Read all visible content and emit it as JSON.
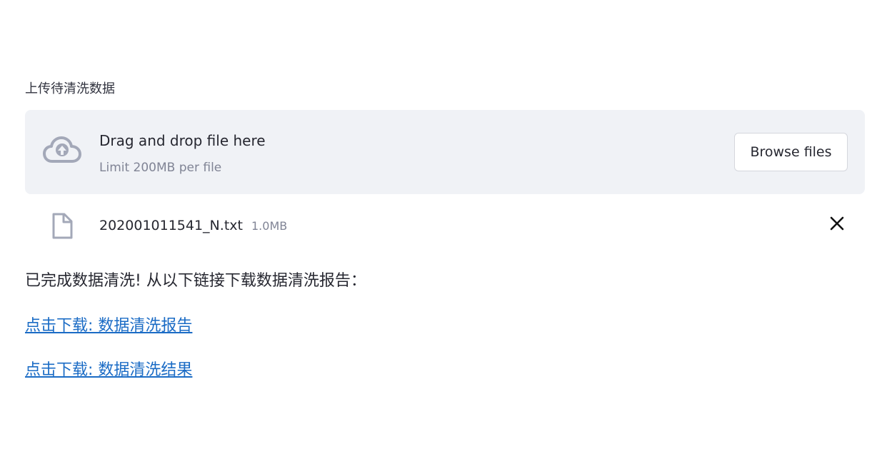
{
  "uploader": {
    "label": "上传待清洗数据",
    "drop_title": "Drag and drop file here",
    "limit_text": "Limit 200MB per file",
    "browse_label": "Browse files",
    "icon": "cloud-upload-icon"
  },
  "uploaded_file": {
    "name": "202001011541_N.txt",
    "size": "1.0MB",
    "icon": "file-icon",
    "remove_icon": "close-icon"
  },
  "status": {
    "message": "已完成数据清洗! 从以下链接下载数据清洗报告："
  },
  "downloads": [
    {
      "label": "点击下载: 数据清洗报告"
    },
    {
      "label": "点击下载: 数据清洗结果"
    }
  ],
  "colors": {
    "dropzone_bg": "#f0f2f6",
    "link": "#1a6bc5",
    "icon": "#a3a8b8",
    "muted_text": "#808495"
  }
}
